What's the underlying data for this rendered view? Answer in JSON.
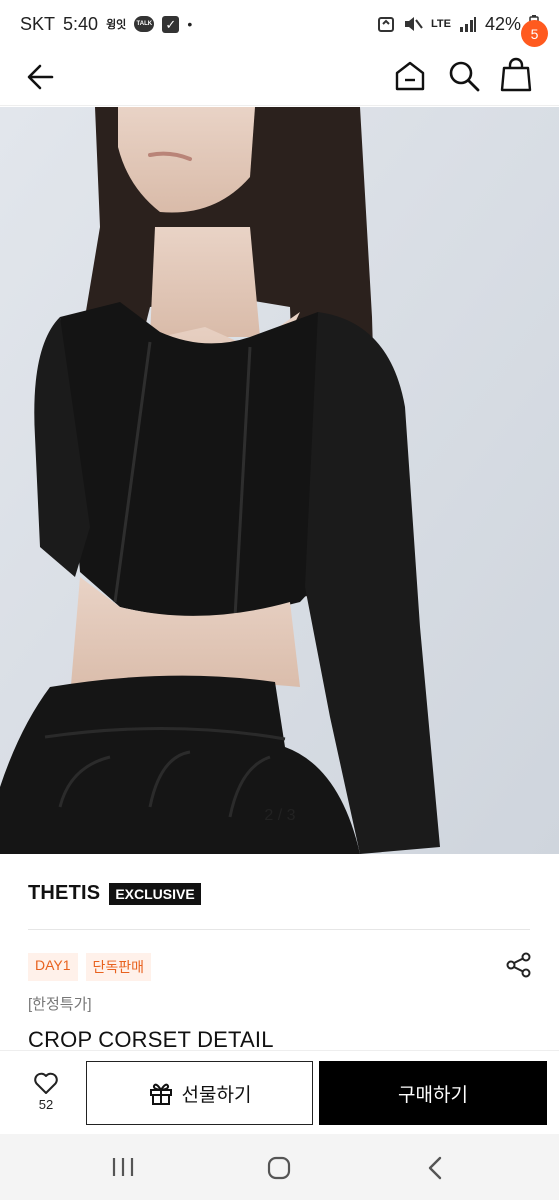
{
  "status_bar": {
    "carrier": "SKT",
    "time": "5:40",
    "app_label": "윙잇",
    "talk_label": "TALK",
    "network": "LTE",
    "battery": "42%"
  },
  "header": {
    "icons": [
      "back-arrow-icon",
      "home-icon",
      "search-icon",
      "shopping-bag-icon"
    ],
    "cart_count": "5"
  },
  "gallery": {
    "pager": "2 / 3",
    "current": 2,
    "total": 3
  },
  "product": {
    "brand": "THETIS",
    "brand_badge": "EXCLUSIVE",
    "tags": [
      "DAY1",
      "단독판매"
    ],
    "promo_label": "[한정특가]",
    "title": "CROP CORSET DETAIL"
  },
  "actions": {
    "like_count": "52",
    "gift_label": "선물하기",
    "buy_label": "구매하기"
  },
  "colors": {
    "accent": "#ff5a1f",
    "tag_bg": "#fff1ea",
    "tag_text": "#e8621f",
    "buy_button": "#000000"
  }
}
